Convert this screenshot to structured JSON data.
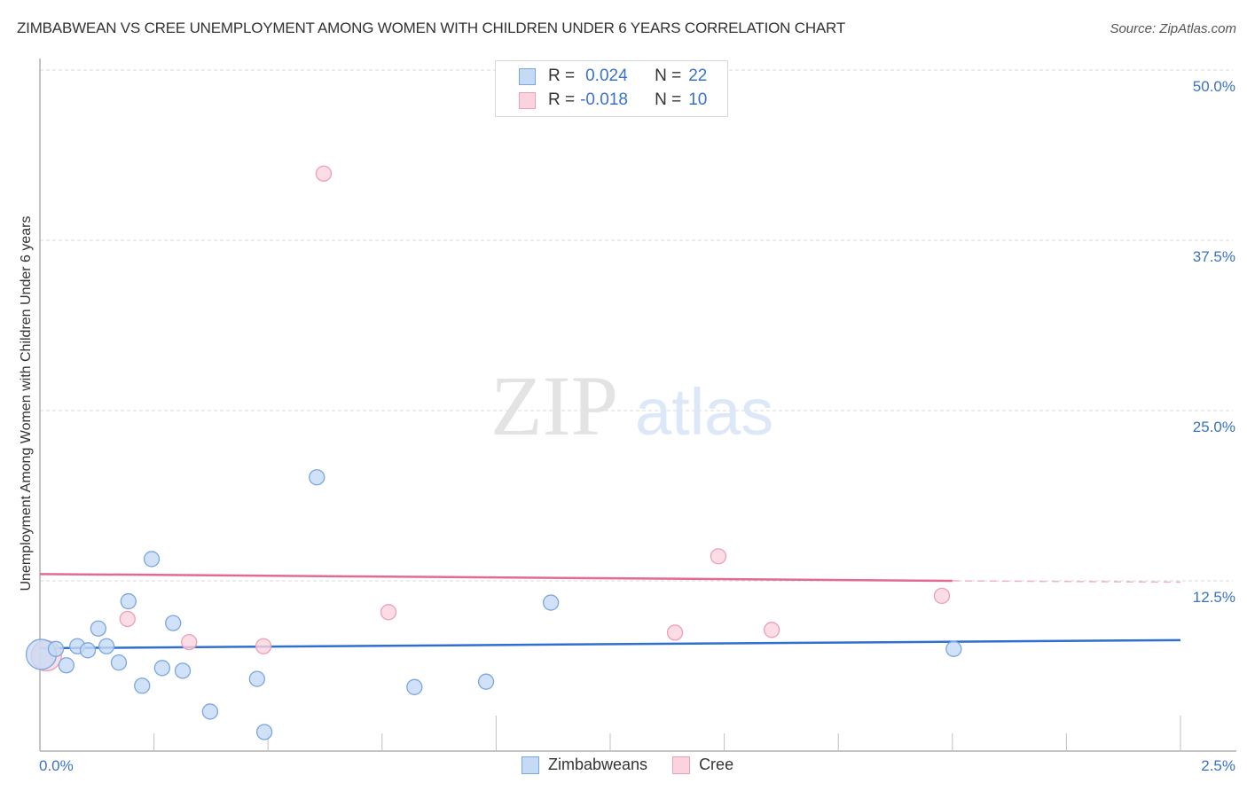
{
  "header": {
    "title": "ZIMBABWEAN VS CREE UNEMPLOYMENT AMONG WOMEN WITH CHILDREN UNDER 6 YEARS CORRELATION CHART",
    "source": "Source: ZipAtlas.com"
  },
  "watermark": {
    "zip": "ZIP",
    "atlas": "atlas"
  },
  "stats_legend": [
    {
      "series": "Zimbabweans",
      "r_label": "R =",
      "r_value": "0.024",
      "n_label": "N =",
      "n_value": "22"
    },
    {
      "series": "Cree",
      "r_label": "R =",
      "r_value": "-0.018",
      "n_label": "N =",
      "n_value": "10"
    }
  ],
  "colors": {
    "blue_fill": "#c5daf5",
    "blue_stroke": "#7aa7e0",
    "blue_line": "#2f6fcf",
    "pink_fill": "#fbd3de",
    "pink_stroke": "#ee9fb6",
    "pink_line": "#e36a91",
    "tick_text": "#3a72c9",
    "grid": "#d9d9d9"
  },
  "chart_data": {
    "type": "scatter",
    "title": "ZIMBABWEAN VS CREE UNEMPLOYMENT AMONG WOMEN WITH CHILDREN UNDER 6 YEARS CORRELATION CHART",
    "xlabel": "",
    "ylabel": "Unemployment Among Women with Children Under 6 years",
    "xlim": [
      0,
      2.5
    ],
    "ylim": [
      0,
      50
    ],
    "x_ticks": [
      {
        "value": 0,
        "label": "0.0%"
      },
      {
        "value": 2.5,
        "label": "2.5%"
      }
    ],
    "y_ticks": [
      {
        "value": 12.5,
        "label": "12.5%"
      },
      {
        "value": 25,
        "label": "25.0%"
      },
      {
        "value": 37.5,
        "label": "37.5%"
      },
      {
        "value": 50,
        "label": "50.0%"
      }
    ],
    "x_minor_ticks": [
      0.25,
      0.5,
      0.75,
      1.0,
      1.25,
      1.5,
      1.75,
      2.0,
      2.25,
      2.5
    ],
    "grid": true,
    "legend": {
      "placement": "bottom",
      "entries": [
        "Zimbabweans",
        "Cree"
      ]
    },
    "series": [
      {
        "name": "Zimbabweans",
        "r": 0.024,
        "n": 22,
        "points": [
          {
            "x": 0.003,
            "y": 7.1,
            "size": "large"
          },
          {
            "x": 0.035,
            "y": 7.5
          },
          {
            "x": 0.058,
            "y": 6.3
          },
          {
            "x": 0.082,
            "y": 7.7
          },
          {
            "x": 0.105,
            "y": 7.4
          },
          {
            "x": 0.128,
            "y": 9.0
          },
          {
            "x": 0.146,
            "y": 7.7
          },
          {
            "x": 0.173,
            "y": 6.5
          },
          {
            "x": 0.194,
            "y": 11.0
          },
          {
            "x": 0.224,
            "y": 4.8
          },
          {
            "x": 0.245,
            "y": 14.1
          },
          {
            "x": 0.268,
            "y": 6.1
          },
          {
            "x": 0.292,
            "y": 9.4
          },
          {
            "x": 0.313,
            "y": 5.9
          },
          {
            "x": 0.373,
            "y": 2.9
          },
          {
            "x": 0.476,
            "y": 5.3
          },
          {
            "x": 0.492,
            "y": 1.4
          },
          {
            "x": 0.607,
            "y": 20.1
          },
          {
            "x": 0.821,
            "y": 4.7
          },
          {
            "x": 0.978,
            "y": 5.1
          },
          {
            "x": 1.12,
            "y": 10.9
          },
          {
            "x": 2.003,
            "y": 7.5
          }
        ],
        "trend": {
          "x0": 0,
          "y0": 7.55,
          "x1": 2.5,
          "y1": 8.15
        }
      },
      {
        "name": "Cree",
        "r": -0.018,
        "n": 10,
        "points": [
          {
            "x": 0.014,
            "y": 7.0,
            "size": "large"
          },
          {
            "x": 0.192,
            "y": 9.7
          },
          {
            "x": 0.327,
            "y": 8.0
          },
          {
            "x": 0.49,
            "y": 7.7
          },
          {
            "x": 0.622,
            "y": 42.4
          },
          {
            "x": 0.764,
            "y": 10.2
          },
          {
            "x": 1.392,
            "y": 8.7
          },
          {
            "x": 1.487,
            "y": 14.3
          },
          {
            "x": 1.604,
            "y": 8.9
          },
          {
            "x": 1.977,
            "y": 11.4
          }
        ],
        "trend": {
          "x0": 0,
          "y0": 13.0,
          "x1": 2.0,
          "y1": 12.5,
          "dashed_to_x": 2.5,
          "dashed_to_y": 12.4
        }
      }
    ]
  }
}
